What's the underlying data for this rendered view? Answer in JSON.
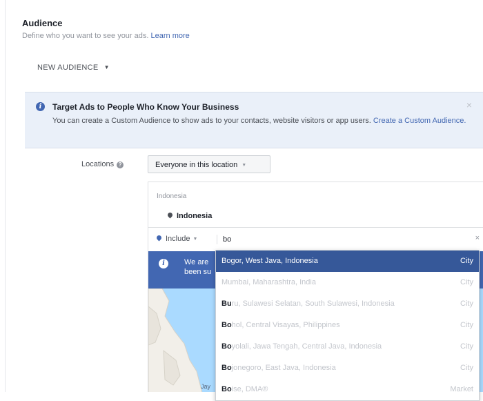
{
  "audience": {
    "title": "Audience",
    "subtitle": "Define who you want to see your ads.",
    "learn_more": "Learn more",
    "new_audience": "NEW AUDIENCE"
  },
  "banner": {
    "title": "Target Ads to People Who Know Your Business",
    "text": "You can create a Custom Audience to show ads to your contacts, website visitors or app users.",
    "link": "Create a Custom Audience.",
    "close_icon": "close-icon"
  },
  "locations": {
    "label": "Locations",
    "help_icon": "help-icon",
    "select_value": "Everyone in this location",
    "country_header": "Indonesia",
    "country_item": "Indonesia",
    "include_label": "Include",
    "search_value": "bo",
    "clear": "×"
  },
  "notice": {
    "text": "We are\nbeen su"
  },
  "map": {
    "attribution": "Jay"
  },
  "suggestions": [
    {
      "match": "",
      "rest": "Bogor, West Java, Indonesia",
      "type": "City"
    },
    {
      "match": "",
      "rest": "Mumbai, Maharashtra, India",
      "type": "City"
    },
    {
      "match": "Bu",
      "rest": "ru, Sulawesi Selatan, South Sulawesi, Indonesia",
      "type": "City"
    },
    {
      "match": "Bo",
      "rest": "hol, Central Visayas, Philippines",
      "type": "City"
    },
    {
      "match": "Bo",
      "rest": "yolali, Jawa Tengah, Central Java, Indonesia",
      "type": "City"
    },
    {
      "match": "Bo",
      "rest": "jonegoro, East Java, Indonesia",
      "type": "City"
    },
    {
      "match": "Bo",
      "rest": "ise, DMA®",
      "type": "Market"
    }
  ],
  "colors": {
    "accent": "#4267b2",
    "highlight": "#365899",
    "banner_bg": "#eaf0f9"
  }
}
